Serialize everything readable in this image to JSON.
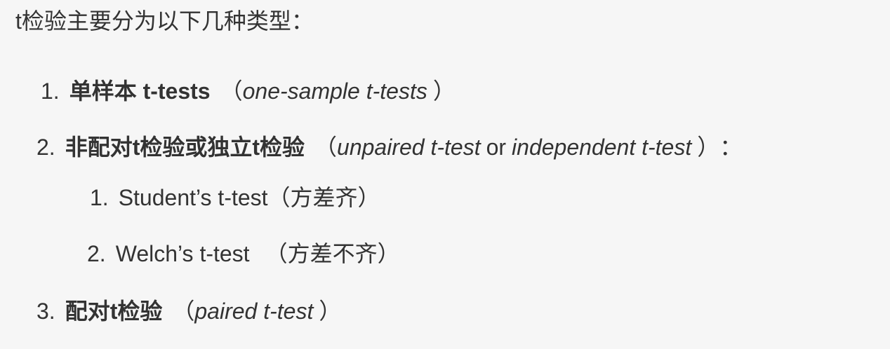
{
  "intro": "t检验主要分为以下几种类型：",
  "items": [
    {
      "num": "1.",
      "bold": "单样本 t-tests",
      "paren_open": "（",
      "italic": "one-sample t-tests",
      "paren_close": "）"
    },
    {
      "num": "2.",
      "bold": "非配对t检验或独立t检验",
      "paren_open": "（",
      "italic1": "unpaired t-test",
      "mid": "or",
      "italic2": "independent t-test",
      "paren_close": "）",
      "suffix": "：",
      "sub": [
        {
          "num": "1.",
          "text": "Student’s t-test（方差齐）"
        },
        {
          "num": "2.",
          "text": "Welch’s t-test",
          "note": "（方差不齐）"
        }
      ]
    },
    {
      "num": "3.",
      "bold": "配对t检验",
      "paren_open": "（",
      "italic": "paired t-test",
      "paren_close": "）"
    }
  ]
}
